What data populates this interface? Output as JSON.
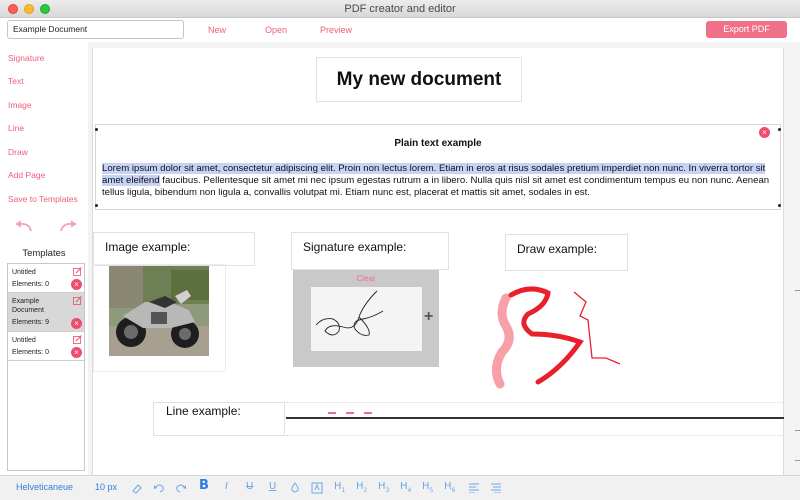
{
  "window": {
    "title": "PDF creator and editor"
  },
  "toolbar": {
    "document_name": "Example Document",
    "new_label": "New",
    "open_label": "Open",
    "preview_label": "Preview",
    "export_label": "Export PDF"
  },
  "sidebar": {
    "items": [
      {
        "label": "Signature"
      },
      {
        "label": "Text"
      },
      {
        "label": "Image"
      },
      {
        "label": "Line"
      },
      {
        "label": "Draw"
      },
      {
        "label": "Add Page"
      },
      {
        "label": "Save to Templates"
      }
    ],
    "undo_icon": "undo-arrow-icon",
    "redo_icon": "redo-arrow-icon",
    "templates_heading": "Templates",
    "templates": [
      {
        "name": "Untitled",
        "elements": "Elements: 0",
        "selected": false
      },
      {
        "name": "Example Document",
        "elements": "Elements: 9",
        "selected": true
      },
      {
        "name": "Untitled",
        "elements": "Elements: 0",
        "selected": false
      }
    ]
  },
  "document": {
    "title": "My new document",
    "text_block": {
      "heading": "Plain text example",
      "selected_text": "Lorem ipsum dolor sit amet, consectetur adipiscing elit. Proin non lectus lorem. Etiam in eros at risus sodales pretium imperdiet non nunc. In viverra tortor sit amet eleifend",
      "rest_text": " faucibus. Pellentesque sit amet mi nec ipsum egestas rutrum a in libero. Nulla quis nisl sit amet est condimentum tempus eu non nunc. Aenean tellus ligula, bibendum non ligula a, convallis volutpat mi. Etiam nunc est, placerat et mattis sit amet, sodales in est."
    },
    "image_label": "Image example:",
    "image_icon": "motorcycle-photo",
    "signature_label": "Signature example:",
    "signature_clear": "Clear",
    "signature_add": "+",
    "draw_label": "Draw example:",
    "line_label": "Line example:"
  },
  "format_bar": {
    "font_name": "Helveticaneue",
    "font_size": "10 px",
    "bold_label": "B",
    "italic_label": "I",
    "underline_label": "U",
    "heading_labels": [
      "H1",
      "H2",
      "H3",
      "H4",
      "H5",
      "H6"
    ]
  },
  "colors": {
    "accent": "#ee5e7a",
    "export_button": "#f0708a",
    "selection": "#c6d3f7",
    "format_blue": "#2f7de1"
  }
}
